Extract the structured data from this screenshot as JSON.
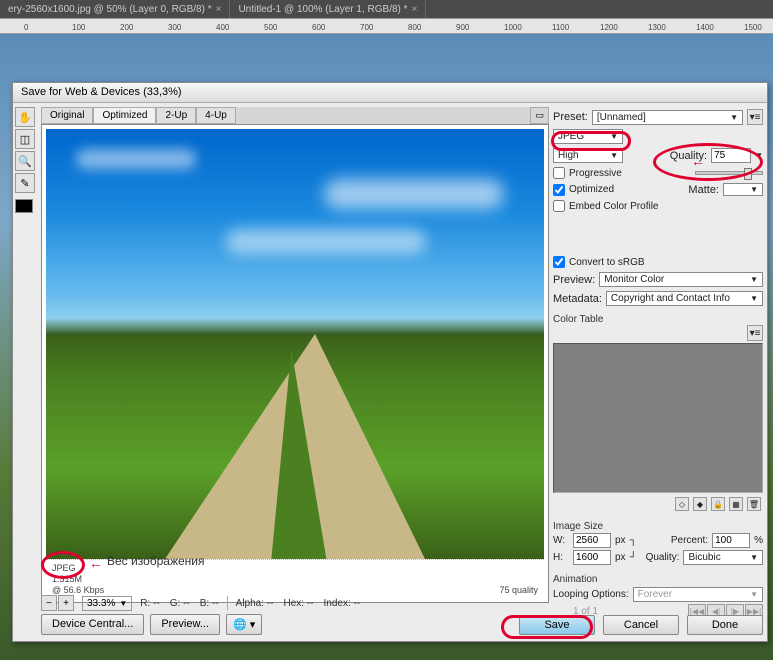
{
  "app_tabs": [
    {
      "label": "ery-2560x1600.jpg @ 50% (Layer 0, RGB/8) *"
    },
    {
      "label": "Untitled-1 @ 100% (Layer 1, RGB/8) *"
    }
  ],
  "ruler_ticks": [
    "0",
    "100",
    "200",
    "300",
    "400",
    "500",
    "600",
    "700",
    "800",
    "900",
    "1000",
    "1100",
    "1200",
    "1300",
    "1400",
    "1500"
  ],
  "dialog": {
    "title": "Save for Web & Devices (33,3%)"
  },
  "preview_tabs": {
    "original": "Original",
    "optimized": "Optimized",
    "two_up": "2-Up",
    "four_up": "4-Up"
  },
  "preview_info": {
    "format": "JPEG",
    "size": "1.315M",
    "speed": "@ 56.6 Kbps",
    "quality_text": "75 quality"
  },
  "annotation_text": "Вес изображения",
  "zoom": {
    "value": "33.3%",
    "r_label": "R:",
    "g_label": "G:",
    "b_label": "B:",
    "r": "--",
    "g": "--",
    "b": "--",
    "alpha_label": "Alpha:",
    "alpha": "--",
    "hex_label": "Hex:",
    "hex": "--",
    "index_label": "Index:",
    "index": "--"
  },
  "bottom_left": {
    "device_central": "Device Central...",
    "preview": "Preview..."
  },
  "right": {
    "preset_label": "Preset:",
    "preset_value": "[Unnamed]",
    "format": "JPEG",
    "quality_sel": "High",
    "quality_label": "Quality:",
    "quality_value": "75",
    "progressive": "Progressive",
    "optimized": "Optimized",
    "matte_label": "Matte:",
    "embed": "Embed Color Profile",
    "convert": "Convert to sRGB",
    "preview_label": "Preview:",
    "preview_value": "Monitor Color",
    "metadata_label": "Metadata:",
    "metadata_value": "Copyright and Contact Info",
    "color_table": "Color Table"
  },
  "image_size": {
    "label": "Image Size",
    "w_label": "W:",
    "w": "2560",
    "h_label": "H:",
    "h": "1600",
    "px": "px",
    "percent_label": "Percent:",
    "percent": "100",
    "percent_sign": "%",
    "quality_label": "Quality:",
    "quality": "Bicubic"
  },
  "animation": {
    "label": "Animation",
    "looping_label": "Looping Options:",
    "looping": "Forever",
    "frame": "1 of 1"
  },
  "buttons": {
    "save": "Save",
    "cancel": "Cancel",
    "done": "Done"
  }
}
